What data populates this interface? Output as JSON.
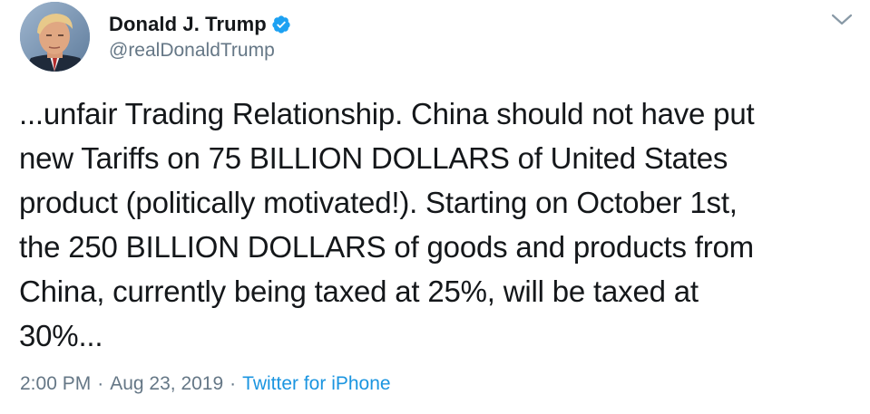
{
  "tweet": {
    "display_name": "Donald J. Trump",
    "handle": "@realDonaldTrump",
    "verified_icon": "verified-badge-icon",
    "more_icon": "chevron-down-icon",
    "text": "...unfair Trading Relationship. China should not have put\nnew Tariffs on 75 BILLION DOLLARS of United States\nproduct (politically motivated!). Starting on October 1st,\nthe 250 BILLION DOLLARS of goods and products from\nChina, currently being taxed at 25%, will be taxed at\n30%...",
    "time": "2:00 PM",
    "separator": "·",
    "date": "Aug 23, 2019",
    "source": "Twitter for iPhone"
  },
  "colors": {
    "text_primary": "#14171a",
    "text_secondary": "#657786",
    "accent": "#1b95e0",
    "verified": "#1da1f2"
  }
}
